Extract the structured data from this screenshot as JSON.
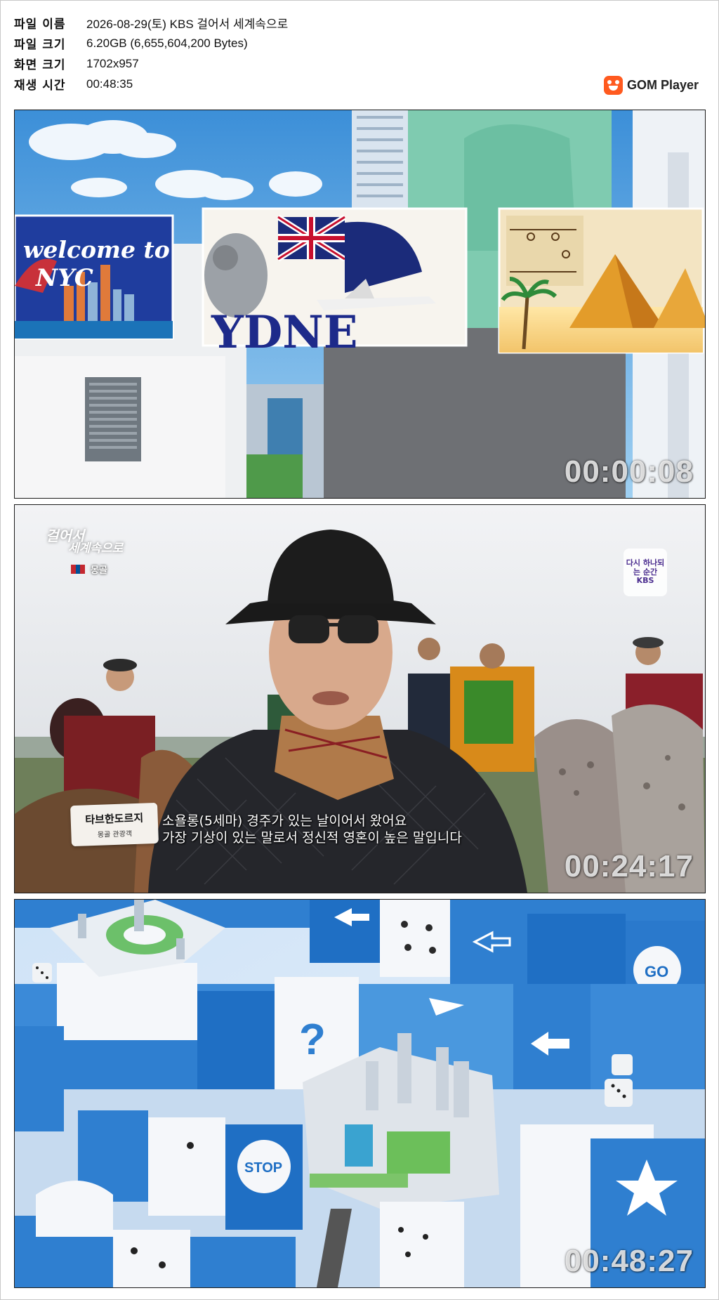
{
  "file_info": {
    "rows": [
      {
        "label": "파일 이름",
        "value": "2026-08-29(토) KBS 걸어서 세계속으로"
      },
      {
        "label": "파일 크기",
        "value": "6.20GB (6,655,604,200 Bytes)"
      },
      {
        "label": "화면 크기",
        "value": "1702x957"
      },
      {
        "label": "재생 시간",
        "value": "00:48:35"
      }
    ]
  },
  "brand": {
    "name": "GOM Player",
    "color": "#ff5a1f"
  },
  "thumbnails": [
    {
      "timestamp": "00:00:08",
      "billboards": [
        "welcome to",
        "NYC",
        "YDNE"
      ]
    },
    {
      "timestamp": "00:24:17",
      "show_logo": [
        "걸어서",
        "세계속으로"
      ],
      "country": "몽골",
      "badge": "다시 하나되는 순간 KBS",
      "person_name": "타브한도르지",
      "person_role": "몽골 관광객",
      "subtitle_lines": [
        "소욜롱(5세마) 경주가 있는 날이어서 왔어요",
        "가장 기상이 있는 말로서 정신적 영혼이 높은 말입니다"
      ]
    },
    {
      "timestamp": "00:48:27",
      "board_labels": [
        "GO",
        "STOP",
        "?"
      ]
    }
  ]
}
